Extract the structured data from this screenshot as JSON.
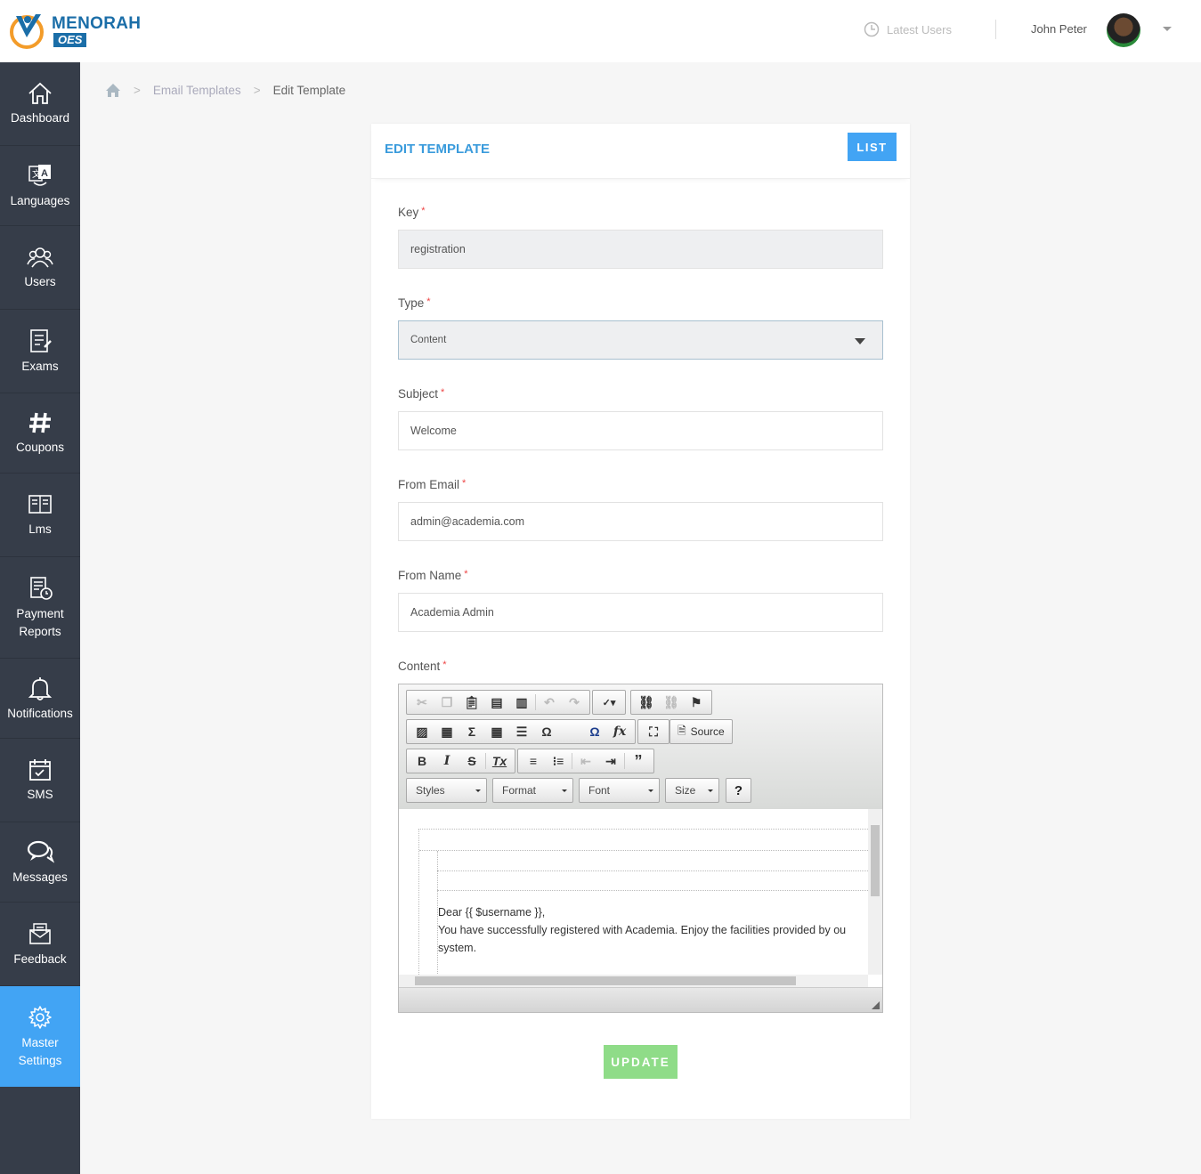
{
  "brand": {
    "name": "MENORAH",
    "badge": "OES"
  },
  "header": {
    "latest_users": "Latest Users",
    "user_name": "John Peter"
  },
  "sidebar": {
    "items": [
      {
        "label": "Dashboard",
        "icon": "home-icon"
      },
      {
        "label": "Languages",
        "icon": "translate-icon"
      },
      {
        "label": "Users",
        "icon": "users-icon"
      },
      {
        "label": "Exams",
        "icon": "exam-icon"
      },
      {
        "label": "Coupons",
        "icon": "hash-icon"
      },
      {
        "label": "Lms",
        "icon": "book-icon"
      },
      {
        "label": "Payment Reports",
        "icon": "payment-report-icon"
      },
      {
        "label": "Notifications",
        "icon": "bell-icon"
      },
      {
        "label": "SMS",
        "icon": "calendar-icon"
      },
      {
        "label": "Messages",
        "icon": "chat-icon"
      },
      {
        "label": "Feedback",
        "icon": "feedback-icon"
      },
      {
        "label": "Master Settings",
        "icon": "gear-icon",
        "active": true
      }
    ]
  },
  "breadcrumb": {
    "level1": "Email Templates",
    "current": "Edit Template"
  },
  "card": {
    "title": "EDIT TEMPLATE",
    "list_button": "LIST"
  },
  "form": {
    "key": {
      "label": "Key",
      "value": "registration"
    },
    "type": {
      "label": "Type",
      "value": "Content"
    },
    "subject": {
      "label": "Subject",
      "value": "Welcome"
    },
    "from_email": {
      "label": "From Email",
      "value": "admin@academia.com"
    },
    "from_name": {
      "label": "From Name",
      "value": "Academia Admin"
    },
    "content": {
      "label": "Content"
    },
    "required_mark": "*"
  },
  "editor": {
    "source_label": "Source",
    "combos": {
      "styles": "Styles",
      "format": "Format",
      "font": "Font",
      "size": "Size"
    },
    "help": "?",
    "body_lines": [
      "Dear {{ $username }},",
      "You have successfully registered with Academia. Enjoy the facilities provided by ou",
      "system."
    ]
  },
  "update_button": "UPDATE",
  "colors": {
    "sidebar": "#363d49",
    "accent": "#42a4f4",
    "update": "#8fdc88",
    "title": "#3a9bdc"
  }
}
